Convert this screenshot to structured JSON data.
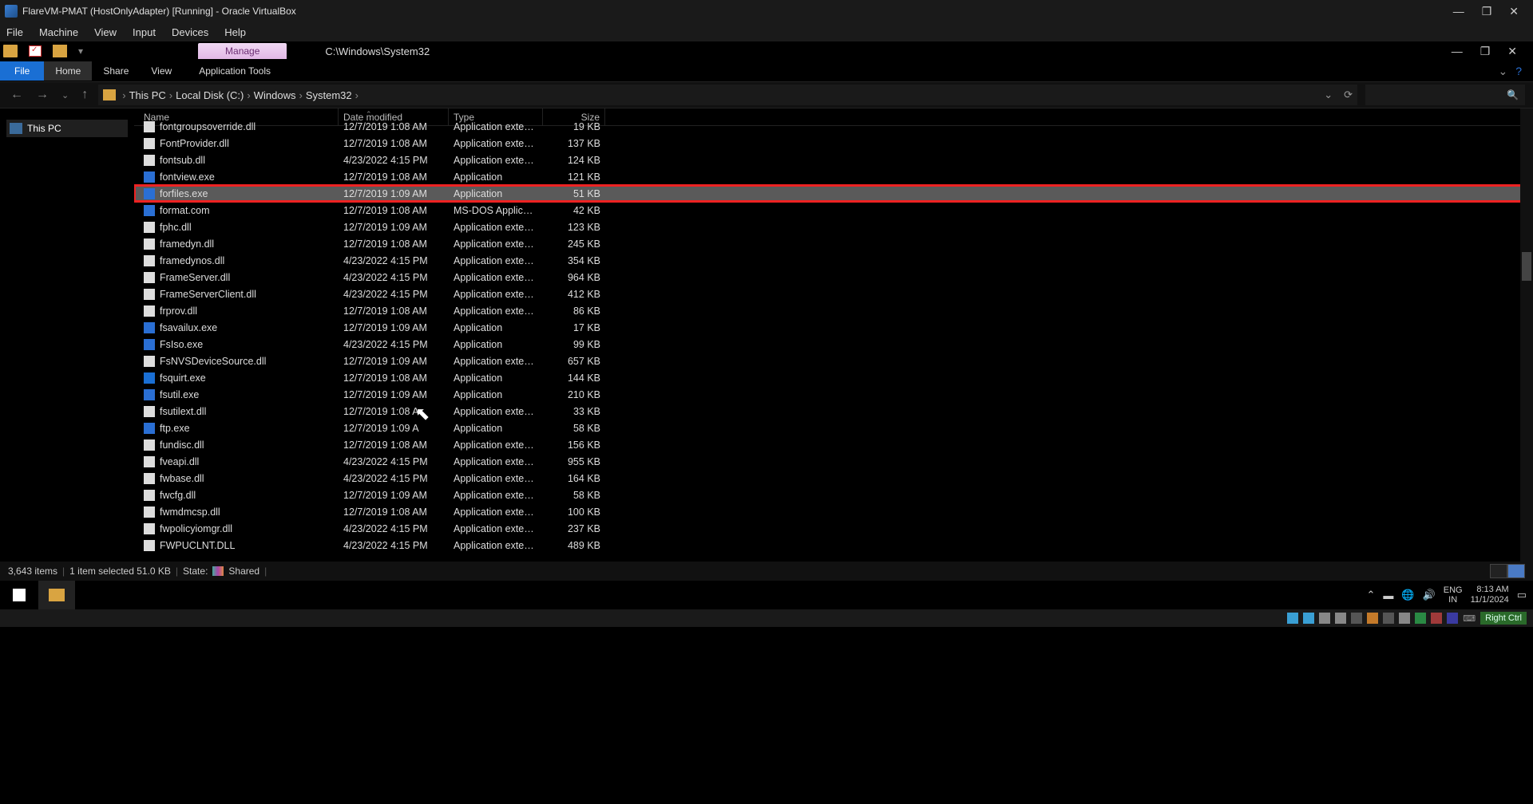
{
  "vbox": {
    "title": "FlareVM-PMAT (HostOnlyAdapter) [Running] - Oracle VirtualBox",
    "menu": [
      "File",
      "Machine",
      "View",
      "Input",
      "Devices",
      "Help"
    ],
    "status_key": "Right Ctrl"
  },
  "explorer": {
    "manage_tab": "Manage",
    "title_path": "C:\\Windows\\System32",
    "tabs": {
      "file": "File",
      "home": "Home",
      "share": "Share",
      "view": "View",
      "app_tools": "Application Tools"
    },
    "breadcrumb": [
      "This PC",
      "Local Disk (C:)",
      "Windows",
      "System32"
    ],
    "nav_pane": {
      "this_pc": "This PC"
    },
    "columns": {
      "name": "Name",
      "date": "Date modified",
      "type": "Type",
      "size": "Size"
    },
    "files": [
      {
        "icon": "dll",
        "name": "fontgroupsoverride.dll",
        "date": "12/7/2019 1:08 AM",
        "type": "Application extens...",
        "size": "19 KB",
        "clipped": true
      },
      {
        "icon": "dll",
        "name": "FontProvider.dll",
        "date": "12/7/2019 1:08 AM",
        "type": "Application extens...",
        "size": "137 KB"
      },
      {
        "icon": "dll",
        "name": "fontsub.dll",
        "date": "4/23/2022 4:15 PM",
        "type": "Application extens...",
        "size": "124 KB"
      },
      {
        "icon": "exe",
        "name": "fontview.exe",
        "date": "12/7/2019 1:08 AM",
        "type": "Application",
        "size": "121 KB"
      },
      {
        "icon": "exe",
        "name": "forfiles.exe",
        "date": "12/7/2019 1:09 AM",
        "type": "Application",
        "size": "51 KB",
        "selected": true,
        "highlight": true
      },
      {
        "icon": "exe",
        "name": "format.com",
        "date": "12/7/2019 1:08 AM",
        "type": "MS-DOS Applicati...",
        "size": "42 KB"
      },
      {
        "icon": "dll",
        "name": "fphc.dll",
        "date": "12/7/2019 1:09 AM",
        "type": "Application extens...",
        "size": "123 KB"
      },
      {
        "icon": "dll",
        "name": "framedyn.dll",
        "date": "12/7/2019 1:08 AM",
        "type": "Application extens...",
        "size": "245 KB"
      },
      {
        "icon": "dll",
        "name": "framedynos.dll",
        "date": "4/23/2022 4:15 PM",
        "type": "Application extens...",
        "size": "354 KB"
      },
      {
        "icon": "dll",
        "name": "FrameServer.dll",
        "date": "4/23/2022 4:15 PM",
        "type": "Application extens...",
        "size": "964 KB"
      },
      {
        "icon": "dll",
        "name": "FrameServerClient.dll",
        "date": "4/23/2022 4:15 PM",
        "type": "Application extens...",
        "size": "412 KB"
      },
      {
        "icon": "dll",
        "name": "frprov.dll",
        "date": "12/7/2019 1:08 AM",
        "type": "Application extens...",
        "size": "86 KB"
      },
      {
        "icon": "exe",
        "name": "fsavailux.exe",
        "date": "12/7/2019 1:09 AM",
        "type": "Application",
        "size": "17 KB"
      },
      {
        "icon": "exe",
        "name": "FsIso.exe",
        "date": "4/23/2022 4:15 PM",
        "type": "Application",
        "size": "99 KB"
      },
      {
        "icon": "dll",
        "name": "FsNVSDeviceSource.dll",
        "date": "12/7/2019 1:09 AM",
        "type": "Application extens...",
        "size": "657 KB"
      },
      {
        "icon": "bt",
        "name": "fsquirt.exe",
        "date": "12/7/2019 1:08 AM",
        "type": "Application",
        "size": "144 KB"
      },
      {
        "icon": "exe",
        "name": "fsutil.exe",
        "date": "12/7/2019 1:09 AM",
        "type": "Application",
        "size": "210 KB"
      },
      {
        "icon": "dll",
        "name": "fsutilext.dll",
        "date": "12/7/2019 1:08 A",
        "type": "Application extens...",
        "size": "33 KB"
      },
      {
        "icon": "exe",
        "name": "ftp.exe",
        "date": "12/7/2019 1:09 A",
        "type": "Application",
        "size": "58 KB"
      },
      {
        "icon": "dll",
        "name": "fundisc.dll",
        "date": "12/7/2019 1:08 AM",
        "type": "Application extens...",
        "size": "156 KB"
      },
      {
        "icon": "dll",
        "name": "fveapi.dll",
        "date": "4/23/2022 4:15 PM",
        "type": "Application extens...",
        "size": "955 KB"
      },
      {
        "icon": "dll",
        "name": "fwbase.dll",
        "date": "4/23/2022 4:15 PM",
        "type": "Application extens...",
        "size": "164 KB"
      },
      {
        "icon": "dll",
        "name": "fwcfg.dll",
        "date": "12/7/2019 1:09 AM",
        "type": "Application extens...",
        "size": "58 KB"
      },
      {
        "icon": "dll",
        "name": "fwmdmcsp.dll",
        "date": "12/7/2019 1:08 AM",
        "type": "Application extens...",
        "size": "100 KB"
      },
      {
        "icon": "dll",
        "name": "fwpolicyiomgr.dll",
        "date": "4/23/2022 4:15 PM",
        "type": "Application extens...",
        "size": "237 KB"
      },
      {
        "icon": "dll",
        "name": "FWPUCLNT.DLL",
        "date": "4/23/2022 4:15 PM",
        "type": "Application extens...",
        "size": "489 KB"
      }
    ],
    "status": {
      "items": "3,643 items",
      "selected": "1 item selected  51.0 KB",
      "state_label": "State:",
      "state_value": "Shared"
    }
  },
  "guest_taskbar": {
    "lang1": "ENG",
    "lang2": "IN",
    "time": "8:13 AM",
    "date": "11/1/2024"
  }
}
